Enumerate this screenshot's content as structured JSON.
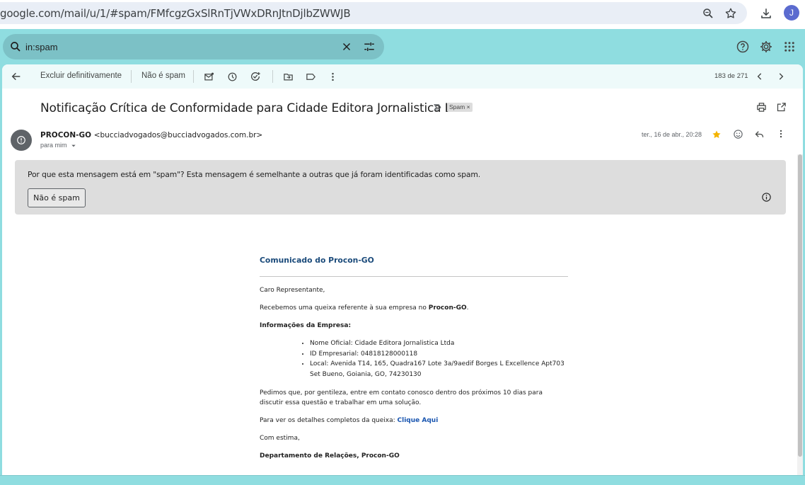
{
  "browser": {
    "url": "google.com/mail/u/1/#spam/FMfcgzGxSlRnTjVWxDRnJtnDjlbZWWJB",
    "avatar_letter": "J"
  },
  "search": {
    "query": "in:spam"
  },
  "toolbar": {
    "delete_forever_label": "Excluir definitivamente",
    "not_spam_label": "Não é spam",
    "page_count": "183 de 271"
  },
  "message": {
    "subject": "Notificação Crítica de Conformidade para Cidade Editora Jornalistica Ltda",
    "label_chip": "Spam",
    "sender_name": "PROCON-GO",
    "sender_email": "<bucciadvogados@bucciadvogados.com.br>",
    "recipient": "para mim",
    "date": "ter., 16 de abr., 20:28"
  },
  "spam_notice": {
    "question": "Por que esta mensagem está em \"spam\"?",
    "explanation": "Esta mensagem é semelhante a outras que já foram identificadas como spam.",
    "button_label": "Não é spam"
  },
  "email_body": {
    "heading": "Comunicado do Procon-GO",
    "greeting": "Caro Representante,",
    "intro_text": "Recebemos uma queixa referente à sua empresa no",
    "intro_bold": "Procon-GO",
    "company_info_heading": "Informações da Empresa:",
    "company_items": [
      "Nome Oficial: Cidade Editora Jornalistica Ltda",
      "ID Empresarial: 04818128000118",
      "Local: Avenida T14, 165, Quadra167 Lote 3a/9aedif Borges L Excellence Apt703 Set Bueno, Goiania, GO, 74230130"
    ],
    "request_text": "Pedimos que, por gentileza, entre em contato conosco dentro dos próximos 10 dias para discutir essa questão e trabalhar em uma solução.",
    "details_text": "Para ver os detalhes completos da queixa:",
    "details_link": "Clique Aqui",
    "closing": "Com estima,",
    "signature": "Departamento de Relações, Procon-GO"
  },
  "colors": {
    "header_bg": "#8fdde0",
    "search_bg": "#7cc1c6",
    "toolbar_bg": "#eefafa",
    "star": "#f4b400",
    "link": "#1a56b0",
    "heading": "#1a4a7a"
  }
}
